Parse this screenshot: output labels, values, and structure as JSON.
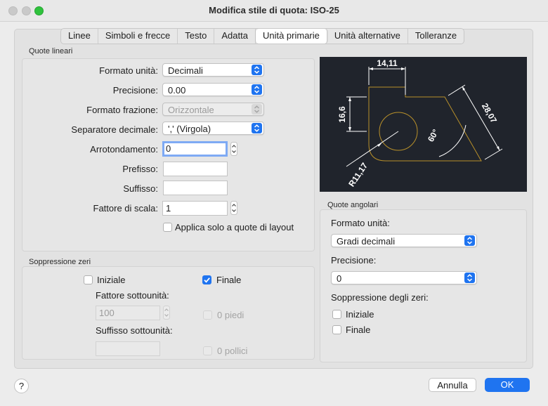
{
  "window": {
    "title": "Modifica stile di quota: ISO-25"
  },
  "tabs": [
    {
      "label": "Linee"
    },
    {
      "label": "Simboli e frecce"
    },
    {
      "label": "Testo"
    },
    {
      "label": "Adatta"
    },
    {
      "label": "Unità primarie",
      "active": true
    },
    {
      "label": "Unità alternative"
    },
    {
      "label": "Tolleranze"
    }
  ],
  "linear": {
    "section_title": "Quote lineari",
    "unit_format_label": "Formato unità:",
    "unit_format_value": "Decimali",
    "precision_label": "Precisione:",
    "precision_value": "0.00",
    "fraction_format_label": "Formato frazione:",
    "fraction_format_value": "Orizzontale",
    "decimal_separator_label": "Separatore decimale:",
    "decimal_separator_value": "',' (Virgola)",
    "round_off_label": "Arrotondamento:",
    "round_off_value": "0",
    "prefix_label": "Prefisso:",
    "prefix_value": "",
    "suffix_label": "Suffisso:",
    "suffix_value": "",
    "scale_factor_label": "Fattore di scala:",
    "scale_factor_value": "1",
    "apply_layout_label": "Applica solo a quote di layout",
    "apply_layout_checked": false
  },
  "zero_suppression": {
    "section_title": "Soppressione zeri",
    "leading_label": "Iniziale",
    "leading_checked": false,
    "trailing_label": "Finale",
    "trailing_checked": true,
    "subunit_factor_label": "Fattore sottounità:",
    "subunit_factor_value": "100",
    "subunit_suffix_label": "Suffisso sottounità:",
    "subunit_suffix_value": "",
    "feet_label": "0 piedi",
    "inches_label": "0 pollici"
  },
  "preview": {
    "dim_top": "14,11",
    "dim_left": "16,6",
    "dim_right": "28,07",
    "dim_angle": "60°",
    "dim_radius": "R11,17",
    "colors": {
      "background": "#20242c",
      "geometry": "#b8902a",
      "dimension": "#ffffff"
    }
  },
  "angular": {
    "section_title": "Quote angolari",
    "unit_format_label": "Formato unità:",
    "unit_format_value": "Gradi decimali",
    "precision_label": "Precisione:",
    "precision_value": "0",
    "zero_suppression_label": "Soppressione degli zeri:",
    "leading_label": "Iniziale",
    "leading_checked": false,
    "trailing_label": "Finale",
    "trailing_checked": false
  },
  "footer": {
    "help_label": "?",
    "cancel_label": "Annulla",
    "ok_label": "OK"
  },
  "accent_color": "#1f74f0"
}
